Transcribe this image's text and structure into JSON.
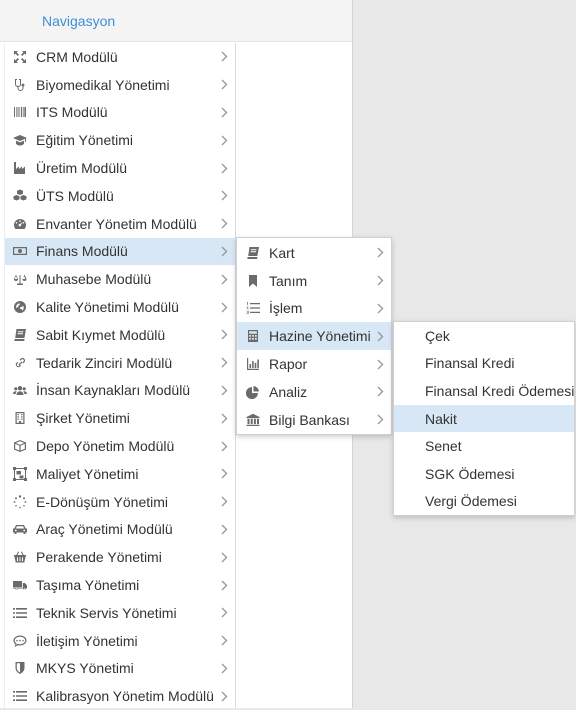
{
  "header": {
    "title": "Navigasyon"
  },
  "main_menu": [
    {
      "label": "CRM Modülü",
      "icon": "crm-icon"
    },
    {
      "label": "Biyomedikal Yönetimi",
      "icon": "stethoscope-icon"
    },
    {
      "label": "ITS Modülü",
      "icon": "barcode-icon"
    },
    {
      "label": "Eğitim Yönetimi",
      "icon": "graduation-cap-icon"
    },
    {
      "label": "Üretim Modülü",
      "icon": "factory-icon"
    },
    {
      "label": "ÜTS Modülü",
      "icon": "cubes-icon"
    },
    {
      "label": "Envanter Yönetim Modülü",
      "icon": "dashboard-icon"
    },
    {
      "label": "Finans Modülü",
      "icon": "money-icon",
      "active": true
    },
    {
      "label": "Muhasebe Modülü",
      "icon": "balance-scale-icon"
    },
    {
      "label": "Kalite Yönetimi Modülü",
      "icon": "globe-icon"
    },
    {
      "label": "Sabit Kıymet Modülü",
      "icon": "book-icon"
    },
    {
      "label": "Tedarik Zinciri Modülü",
      "icon": "link-icon"
    },
    {
      "label": "İnsan Kaynakları Modülü",
      "icon": "users-icon"
    },
    {
      "label": "Şirket Yönetimi",
      "icon": "building-icon"
    },
    {
      "label": "Depo Yönetim Modülü",
      "icon": "cube-icon"
    },
    {
      "label": "Maliyet Yönetimi",
      "icon": "object-group-icon"
    },
    {
      "label": "E-Dönüşüm Yönetimi",
      "icon": "spinner-icon"
    },
    {
      "label": "Araç Yönetimi Modülü",
      "icon": "car-icon"
    },
    {
      "label": "Perakende Yönetimi",
      "icon": "basket-icon"
    },
    {
      "label": "Taşıma Yönetimi",
      "icon": "truck-icon"
    },
    {
      "label": "Teknik Servis Yönetimi",
      "icon": "list-icon"
    },
    {
      "label": "İletişim Yönetimi",
      "icon": "comment-icon"
    },
    {
      "label": "MKYS Yönetimi",
      "icon": "shield-icon"
    },
    {
      "label": "Kalibrasyon Yönetim Modülü",
      "icon": "list-icon"
    }
  ],
  "sub_menu": [
    {
      "label": "Kart",
      "icon": "book-icon"
    },
    {
      "label": "Tanım",
      "icon": "bookmark-icon"
    },
    {
      "label": "İşlem",
      "icon": "list-ol-icon"
    },
    {
      "label": "Hazine Yönetimi",
      "icon": "calculator-icon",
      "active": true
    },
    {
      "label": "Rapor",
      "icon": "bar-chart-icon"
    },
    {
      "label": "Analiz",
      "icon": "pie-chart-icon"
    },
    {
      "label": "Bilgi Bankası",
      "icon": "bank-icon"
    }
  ],
  "hazine_menu": [
    {
      "label": "Çek"
    },
    {
      "label": "Finansal Kredi"
    },
    {
      "label": "Finansal Kredi Ödemesi"
    },
    {
      "label": "Nakit",
      "active": true
    },
    {
      "label": "Senet"
    },
    {
      "label": "SGK Ödemesi"
    },
    {
      "label": "Vergi Ödemesi"
    }
  ],
  "colors": {
    "accent": "#3b8fd6",
    "active_bg": "#d7e7f5",
    "icon": "#6b6b6b"
  }
}
